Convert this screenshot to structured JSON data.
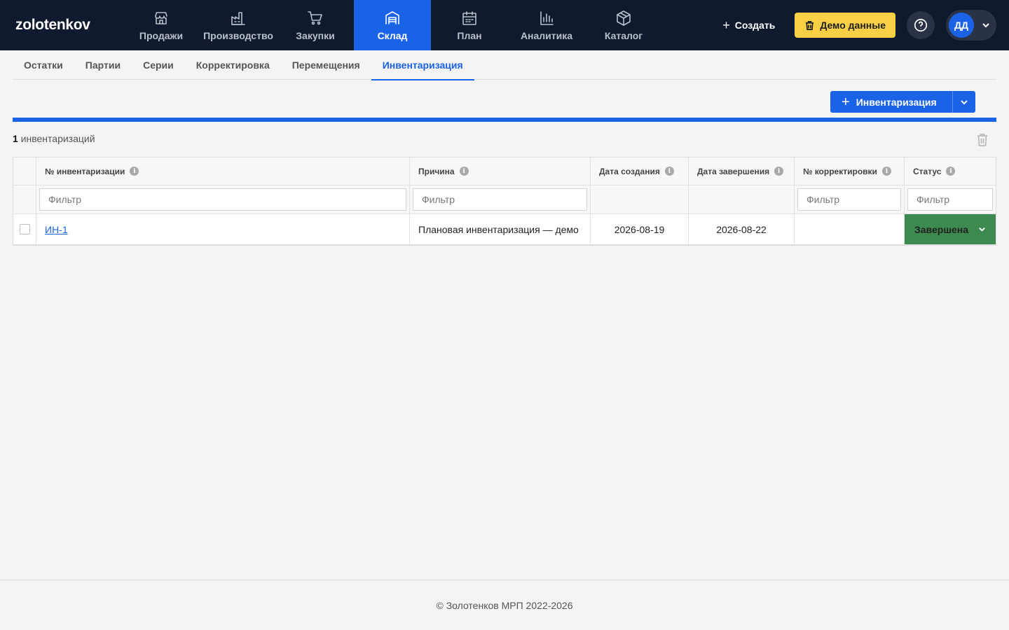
{
  "app": {
    "logo": "zolotenkov"
  },
  "nav": {
    "items": [
      {
        "label": "Продажи",
        "icon": "store-icon"
      },
      {
        "label": "Производство",
        "icon": "factory-icon"
      },
      {
        "label": "Закупки",
        "icon": "cart-icon"
      },
      {
        "label": "Склад",
        "icon": "warehouse-icon",
        "active": true
      },
      {
        "label": "План",
        "icon": "calendar-icon"
      },
      {
        "label": "Аналитика",
        "icon": "bar-chart-icon"
      },
      {
        "label": "Каталог",
        "icon": "box-icon"
      }
    ]
  },
  "header": {
    "create_label": "Создать",
    "demo_label": "Демо данные",
    "user_initials": "ДД"
  },
  "subtabs": {
    "items": [
      "Остатки",
      "Партии",
      "Серии",
      "Корректировка",
      "Перемещения",
      "Инвентаризация"
    ],
    "active": "Инвентаризация"
  },
  "actions": {
    "add_label": "Инвентаризация"
  },
  "list": {
    "count": "1",
    "count_label": "инвентаризаций"
  },
  "table": {
    "columns": [
      "№ инвентаризации",
      "Причина",
      "Дата создания",
      "Дата завершения",
      "№ корректировки",
      "Статус"
    ],
    "filter_placeholder": "Фильтр",
    "rows": [
      {
        "number": "ИН-1",
        "reason": "Плановая инвентаризация — демо",
        "created": "2026-08-19",
        "completed": "2026-08-22",
        "adjustment": "",
        "status": "Завершена"
      }
    ]
  },
  "colors": {
    "accent": "#1a63e6",
    "topbar": "#0f1a2e",
    "status_done": "#3c8a4f",
    "demo": "#f7d046"
  },
  "footer": {
    "text": "© Золотенков МРП 2022-2026"
  }
}
